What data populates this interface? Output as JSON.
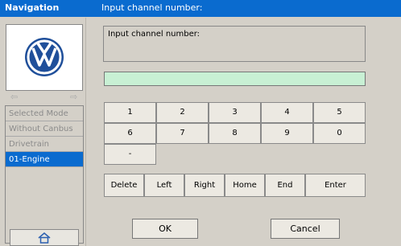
{
  "titlebar": {
    "nav_title": "Navigation",
    "page_title": "Input channel number:"
  },
  "sidebar": {
    "logo": "vw-logo",
    "back_icon": "arrow-left-icon",
    "forward_icon": "arrow-right-icon",
    "items": [
      {
        "label": "Selected Mode"
      },
      {
        "label": "Without Canbus"
      },
      {
        "label": "Drivetrain"
      },
      {
        "label": "01-Engine",
        "active": true
      }
    ],
    "home_icon": "home-icon"
  },
  "main": {
    "prompt": "Input channel number:",
    "input_value": "",
    "keypad": [
      "1",
      "2",
      "3",
      "4",
      "5",
      "6",
      "7",
      "8",
      "9",
      "0",
      "-"
    ],
    "controls": [
      "Delete",
      "Left",
      "Right",
      "Home",
      "End",
      "Enter"
    ],
    "ok_label": "OK",
    "cancel_label": "Cancel"
  },
  "colors": {
    "titlebar": "#0a6bcf",
    "input_bg": "#c8f0d4",
    "panel_bg": "#d4d0c8"
  }
}
